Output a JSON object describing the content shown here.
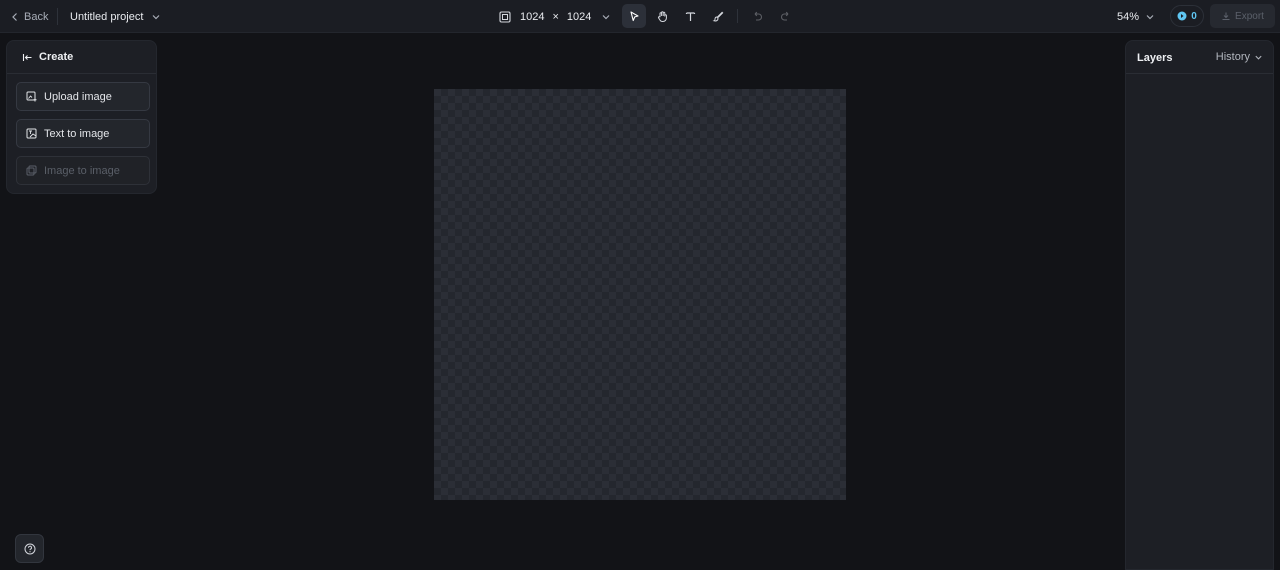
{
  "topbar": {
    "back_label": "Back",
    "project_name": "Untitled project",
    "canvas_width": "1024",
    "size_separator": "×",
    "canvas_height": "1024",
    "zoom_level": "54%",
    "credits": "0",
    "export_label": "Export"
  },
  "tools": [
    {
      "name": "select-tool",
      "icon": "pointer-icon",
      "active": true
    },
    {
      "name": "hand-tool",
      "icon": "hand-icon",
      "active": false
    },
    {
      "name": "text-tool",
      "icon": "text-icon",
      "active": false
    },
    {
      "name": "brush-tool",
      "icon": "brush-icon",
      "active": false
    },
    {
      "name": "undo",
      "icon": "undo-icon",
      "disabled": true
    },
    {
      "name": "redo",
      "icon": "redo-icon",
      "disabled": true
    }
  ],
  "left_panel": {
    "title": "Create",
    "options": [
      {
        "label": "Upload image",
        "icon": "upload-image-icon",
        "disabled": false
      },
      {
        "label": "Text to image",
        "icon": "text-to-image-icon",
        "disabled": false
      },
      {
        "label": "Image to image",
        "icon": "image-to-image-icon",
        "disabled": true
      }
    ]
  },
  "right_panel": {
    "layers_label": "Layers",
    "history_label": "History"
  },
  "colors": {
    "background": "#121317",
    "panel": "#1d1f25",
    "accent": "#5fc6f2"
  }
}
